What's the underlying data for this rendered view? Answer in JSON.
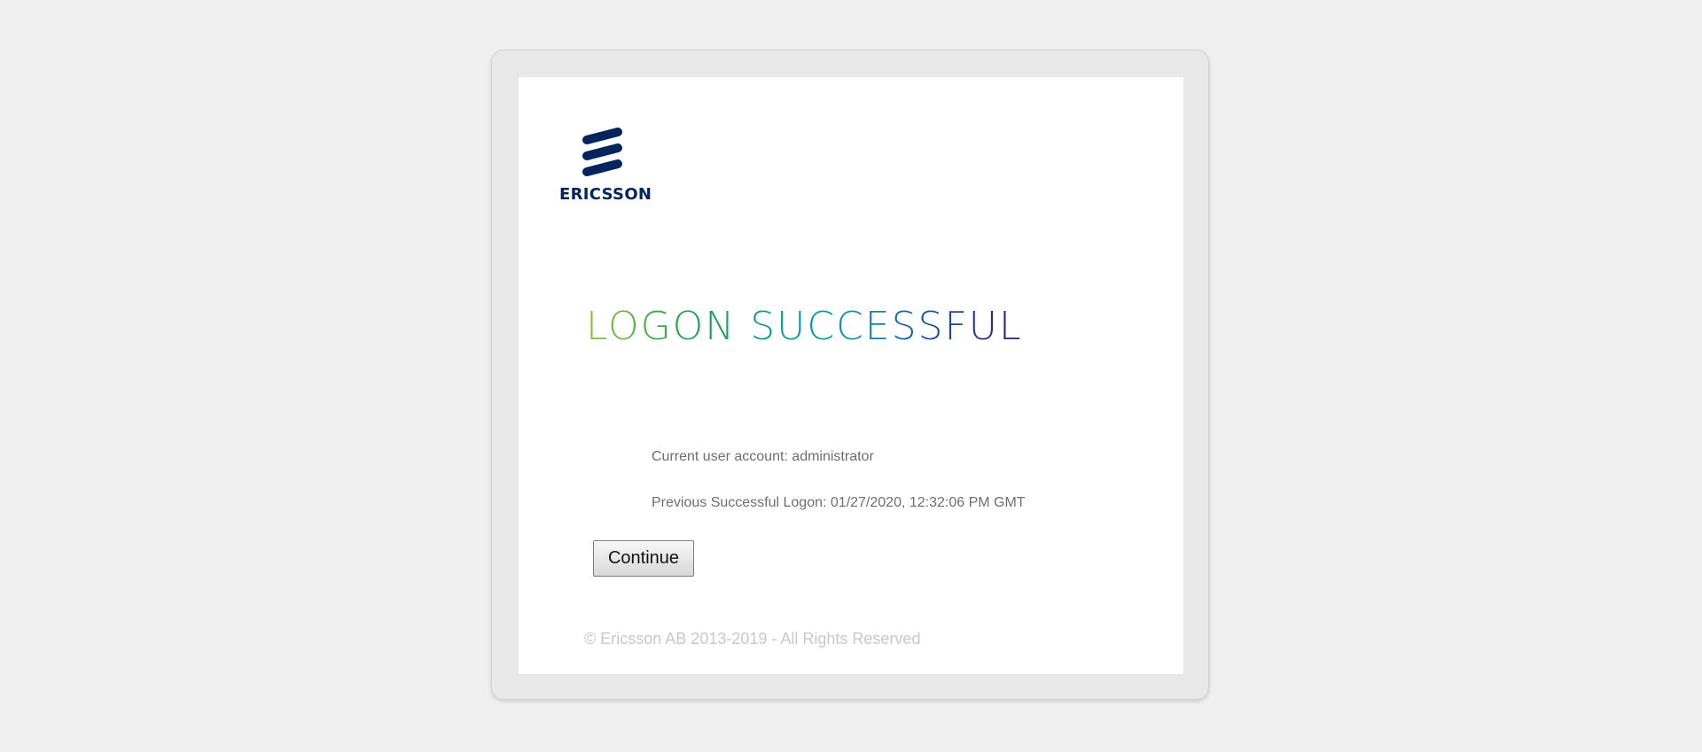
{
  "brand": {
    "name": "ERICSSON",
    "color": "#002561"
  },
  "headline": "LOGON SUCCESSFUL",
  "info": {
    "account": "Current user account: administrator",
    "previous_logon": "Previous Successful Logon: 01/27/2020, 12:32:06 PM GMT"
  },
  "actions": {
    "continue_label": "Continue"
  },
  "footer": {
    "copyright": "© Ericsson AB 2013-2019 - All Rights Reserved"
  }
}
